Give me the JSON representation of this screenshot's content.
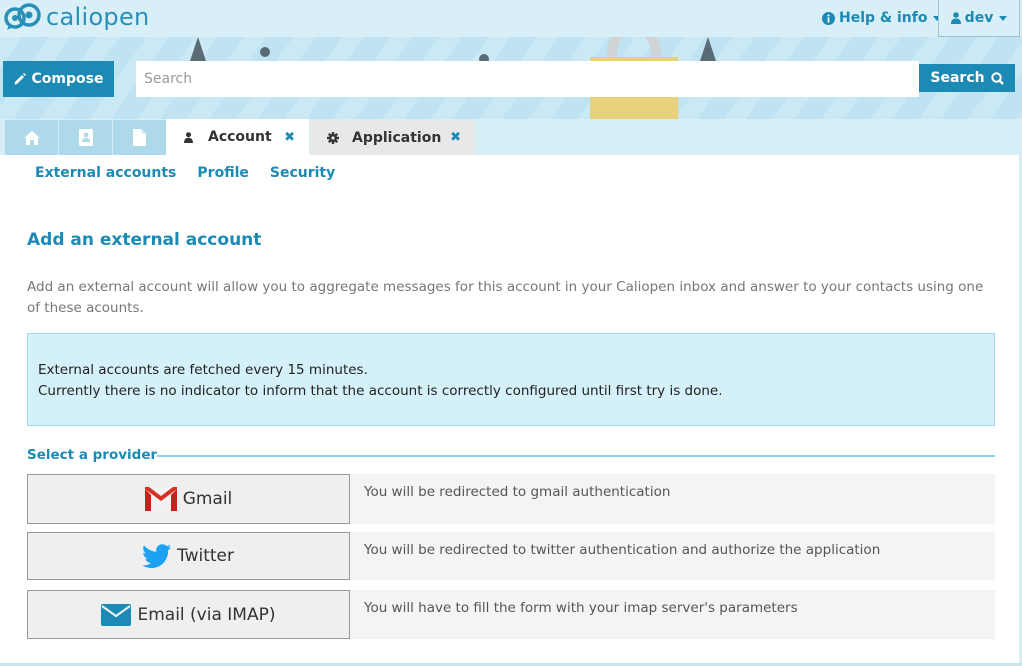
{
  "app": {
    "logo_text": "caliopen"
  },
  "topbar": {
    "help_label": "Help & info",
    "user_label": "dev"
  },
  "banner": {
    "compose_label": "Compose",
    "search_placeholder": "Search",
    "search_button_label": "Search"
  },
  "tabs": [
    {
      "label": "Account",
      "icon": "user-icon",
      "active": true
    },
    {
      "label": "Application",
      "icon": "gear-icon",
      "active": false
    }
  ],
  "subnav": {
    "items": [
      "External accounts",
      "Profile",
      "Security"
    ]
  },
  "main": {
    "title": "Add an external account",
    "description": "Add an external account will allow you to aggregate messages for this account in your Caliopen inbox and answer to your contacts using one of these acounts.",
    "alert_line1": "External accounts are fetched every 15 minutes.",
    "alert_line2": "Currently there is no indicator to inform that the account is correctly configured until first try is done.",
    "select_label": "Select a provider"
  },
  "providers": [
    {
      "label": "Gmail",
      "icon": "gmail-icon",
      "description": "You will be redirected to gmail authentication"
    },
    {
      "label": "Twitter",
      "icon": "twitter-icon",
      "description": "You will be redirected to twitter authentication and authorize the application"
    },
    {
      "label": "Email (via IMAP)",
      "icon": "envelope-icon",
      "description": "You will have to fill the form with your imap server's parameters"
    }
  ],
  "colors": {
    "accent": "#1b8ab5",
    "alert_bg": "#d4f0f8",
    "tab_inactive": "#aed9ea"
  }
}
